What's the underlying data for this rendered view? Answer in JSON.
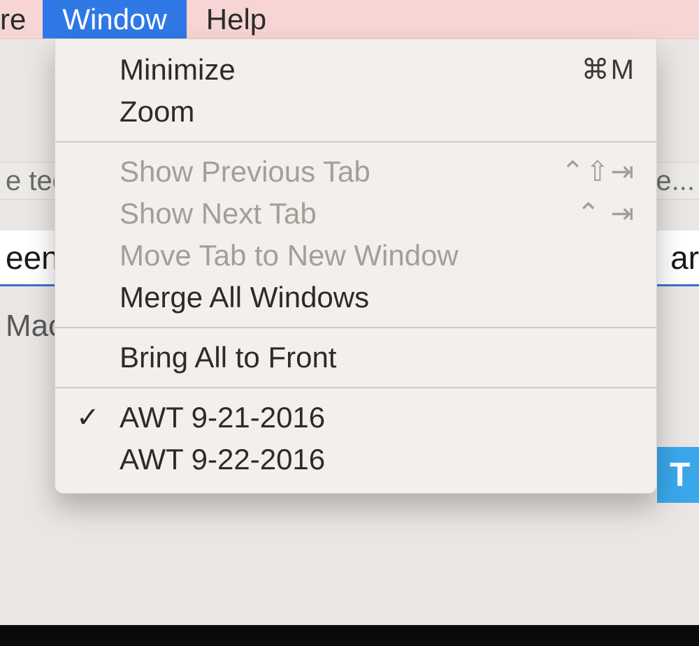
{
  "menubar": {
    "prev_truncated": "re",
    "window": "Window",
    "help": "Help"
  },
  "background": {
    "tab_left": "e tec.",
    "tab_right": "e...",
    "search_left": "een",
    "search_right": "ar",
    "sub_left": "Mac",
    "button_right": "T"
  },
  "menu": {
    "minimize": {
      "label": "Minimize",
      "shortcut": "⌘M"
    },
    "zoom": {
      "label": "Zoom"
    },
    "show_prev_tab": {
      "label": "Show Previous Tab",
      "shortcut": "⌃⇧⇥"
    },
    "show_next_tab": {
      "label": "Show Next Tab",
      "shortcut": "⌃ ⇥"
    },
    "move_tab": {
      "label": "Move Tab to New Window"
    },
    "merge_all": {
      "label": "Merge All Windows"
    },
    "bring_front": {
      "label": "Bring All to Front"
    },
    "win1": {
      "label": "AWT 9-21-2016",
      "check": "✓"
    },
    "win2": {
      "label": "AWT 9-22-2016"
    }
  }
}
